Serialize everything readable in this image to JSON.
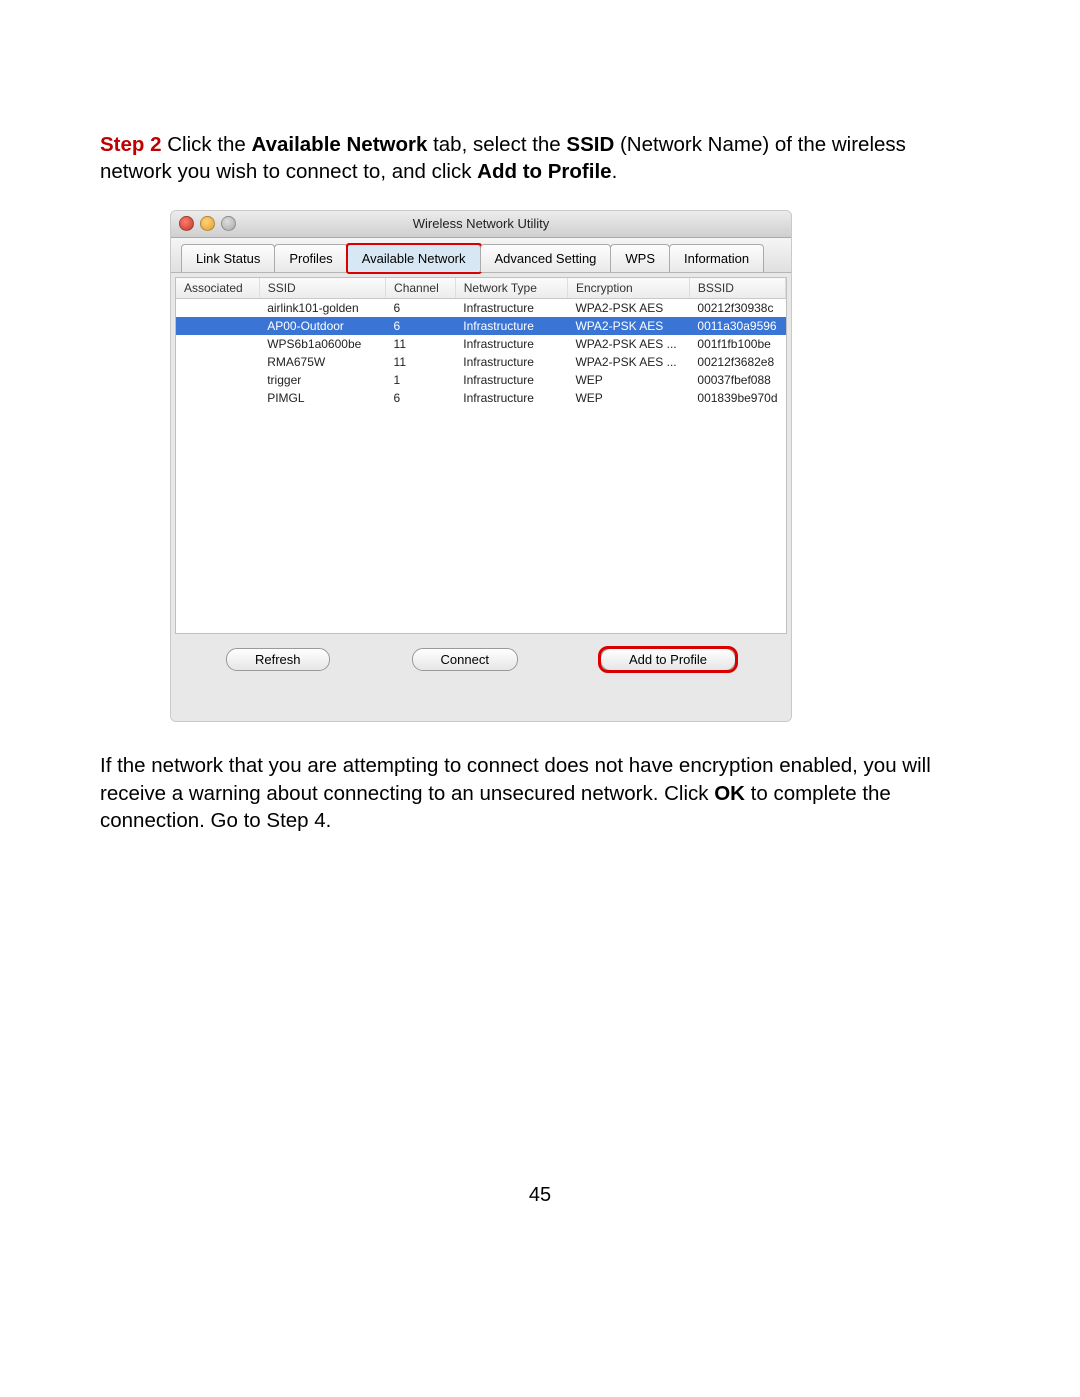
{
  "instruction": {
    "step_label": "Step 2",
    "pre": " Click the ",
    "b1": "Available Network",
    "mid1": " tab, select the ",
    "b2": "SSID",
    "mid2": " (Network Name) of the wireless network you wish to connect to, and click ",
    "b3": "Add to Profile",
    "post": "."
  },
  "window": {
    "title": "Wireless Network Utility",
    "tabs": [
      "Link Status",
      "Profiles",
      "Available Network",
      "Advanced Setting",
      "WPS",
      "Information"
    ],
    "active_tab": "Available Network",
    "columns": [
      "Associated",
      "SSID",
      "Channel",
      "Network Type",
      "Encryption",
      "BSSID"
    ],
    "rows": [
      {
        "assoc": "",
        "ssid": "airlink101-golden",
        "chan": "6",
        "type": "Infrastructure",
        "enc": "WPA2-PSK AES",
        "bssid": "00212f30938c",
        "selected": false
      },
      {
        "assoc": "",
        "ssid": "AP00-Outdoor",
        "chan": "6",
        "type": "Infrastructure",
        "enc": "WPA2-PSK AES",
        "bssid": "0011a30a9596",
        "selected": true
      },
      {
        "assoc": "",
        "ssid": "WPS6b1a0600be",
        "chan": "11",
        "type": "Infrastructure",
        "enc": "WPA2-PSK AES ...",
        "bssid": "001f1fb100be",
        "selected": false
      },
      {
        "assoc": "",
        "ssid": "RMA675W",
        "chan": "11",
        "type": "Infrastructure",
        "enc": "WPA2-PSK AES ...",
        "bssid": "00212f3682e8",
        "selected": false
      },
      {
        "assoc": "",
        "ssid": "trigger",
        "chan": "1",
        "type": "Infrastructure",
        "enc": "WEP",
        "bssid": "00037fbef088",
        "selected": false
      },
      {
        "assoc": "",
        "ssid": "PIMGL",
        "chan": "6",
        "type": "Infrastructure",
        "enc": "WEP",
        "bssid": "001839be970d",
        "selected": false
      }
    ],
    "buttons": {
      "refresh": "Refresh",
      "connect": "Connect",
      "add": "Add to Profile"
    }
  },
  "footnote": {
    "pre": "If the network that you are attempting to connect does not have encryption enabled, you will receive a warning about connecting to an unsecured network. Click ",
    "b1": "OK",
    "mid": " to complete the connection. Go to ",
    "step": "Step 4",
    "post": "."
  },
  "page_number": "45"
}
